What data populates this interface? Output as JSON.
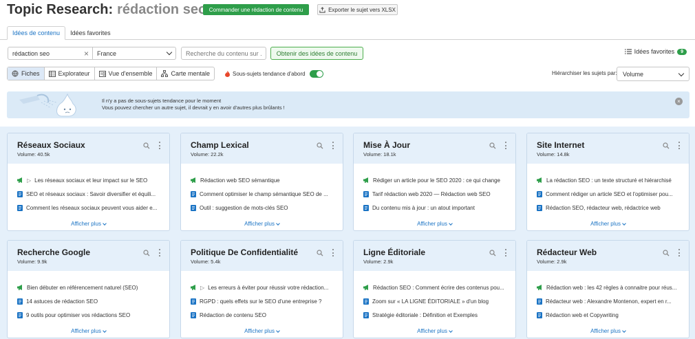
{
  "header": {
    "title": "Topic Research:",
    "keyword": "rédaction seo",
    "order_button": "Commander une rédaction de contenu",
    "export_button": "Exporter le sujet vers XLSX"
  },
  "tabs": [
    "Idées de contenu",
    "Idées favorites"
  ],
  "search": {
    "value": "rédaction seo",
    "country": "France",
    "content_placeholder": "Recherche du contenu sur ...",
    "get_ideas_button": "Obtenir des idées de contenu"
  },
  "favorites": {
    "label": "Idées favorites",
    "count": "9"
  },
  "views": [
    "Fiches",
    "Explorateur",
    "Vue d'ensemble",
    "Carte mentale"
  ],
  "trending_label": "Sous-sujets tendance d'abord",
  "sort": {
    "label": "Hiérarchiser les sujets par:",
    "value": "Volume"
  },
  "notice": {
    "line1": "Il n'y a pas de sous-sujets tendance pour le moment",
    "line2": "Vous pouvez chercher un autre sujet, il devrait y en avoir d'autres plus brûlants !"
  },
  "show_more": "Afficher plus",
  "cards": [
    {
      "title": "Réseaux Sociaux",
      "volume": "Volume: 40.5k",
      "items": [
        {
          "icon": "megaphone",
          "arrow": true,
          "text": "Les réseaux sociaux et leur impact sur le SEO"
        },
        {
          "icon": "doc",
          "arrow": false,
          "text": "SEO et réseaux sociaux : Savoir diversifier et équili..."
        },
        {
          "icon": "doc",
          "arrow": false,
          "text": "Comment les réseaux sociaux peuvent vous aider e..."
        }
      ]
    },
    {
      "title": "Champ Lexical",
      "volume": "Volume: 22.2k",
      "items": [
        {
          "icon": "megaphone",
          "arrow": false,
          "text": "Rédaction web SEO sémantique"
        },
        {
          "icon": "doc",
          "arrow": false,
          "text": "Comment optimiser le champ sémantique SEO de ..."
        },
        {
          "icon": "doc",
          "arrow": false,
          "text": "Outil : suggestion de mots-clés SEO"
        }
      ]
    },
    {
      "title": "Mise À Jour",
      "volume": "Volume: 18.1k",
      "items": [
        {
          "icon": "megaphone",
          "arrow": false,
          "text": "Rédiger un article pour le SEO 2020 : ce qui change"
        },
        {
          "icon": "doc",
          "arrow": false,
          "text": "Tarif rédaction web 2020 — Rédaction web SEO"
        },
        {
          "icon": "doc",
          "arrow": false,
          "text": "Du contenu mis à jour : un atout important"
        }
      ]
    },
    {
      "title": "Site Internet",
      "volume": "Volume: 14.8k",
      "items": [
        {
          "icon": "megaphone",
          "arrow": false,
          "text": "La rédaction SEO : un texte structuré et hiérarchisé"
        },
        {
          "icon": "doc",
          "arrow": false,
          "text": "Comment rédiger un article SEO et l'optimiser pou..."
        },
        {
          "icon": "doc",
          "arrow": false,
          "text": "Rédaction SEO, rédacteur web, rédactrice web"
        }
      ]
    },
    {
      "title": "Recherche Google",
      "volume": "Volume: 9.9k",
      "items": [
        {
          "icon": "megaphone",
          "arrow": false,
          "text": "Bien débuter en référencement naturel (SEO)"
        },
        {
          "icon": "doc",
          "arrow": false,
          "text": "14 astuces de rédaction SEO"
        },
        {
          "icon": "doc",
          "arrow": false,
          "text": "9 outils pour optimiser vos rédactions SEO"
        }
      ]
    },
    {
      "title": "Politique De Confidentialité",
      "volume": "Volume: 5.4k",
      "items": [
        {
          "icon": "megaphone",
          "arrow": true,
          "text": "Les erreurs à éviter pour réussir votre rédaction..."
        },
        {
          "icon": "doc",
          "arrow": false,
          "text": "RGPD : quels effets sur le SEO d'une entreprise ?"
        },
        {
          "icon": "doc",
          "arrow": false,
          "text": "Rédaction de contenu SEO"
        }
      ]
    },
    {
      "title": "Ligne Éditoriale",
      "volume": "Volume: 2.9k",
      "items": [
        {
          "icon": "megaphone",
          "arrow": false,
          "text": "Rédaction SEO : Comment écrire des contenus pou..."
        },
        {
          "icon": "doc",
          "arrow": false,
          "text": "Zoom sur « LA LIGNE ÉDITORIALE » d'un blog"
        },
        {
          "icon": "doc",
          "arrow": false,
          "text": "Stratégie éditoriale : Définition et Exemples"
        }
      ]
    },
    {
      "title": "Rédacteur Web",
      "volume": "Volume: 2.9k",
      "items": [
        {
          "icon": "megaphone",
          "arrow": false,
          "text": "Rédaction web : les 42 règles à connaitre pour réus..."
        },
        {
          "icon": "doc",
          "arrow": false,
          "text": "Rédacteur web : Alexandre Montenon, expert en r..."
        },
        {
          "icon": "doc",
          "arrow": false,
          "text": "Rédaction web et Copywriting"
        }
      ]
    }
  ],
  "colors": {
    "green": "#2e9e4a",
    "blue": "#1a73c4",
    "card_header": "#e5f0fa"
  }
}
